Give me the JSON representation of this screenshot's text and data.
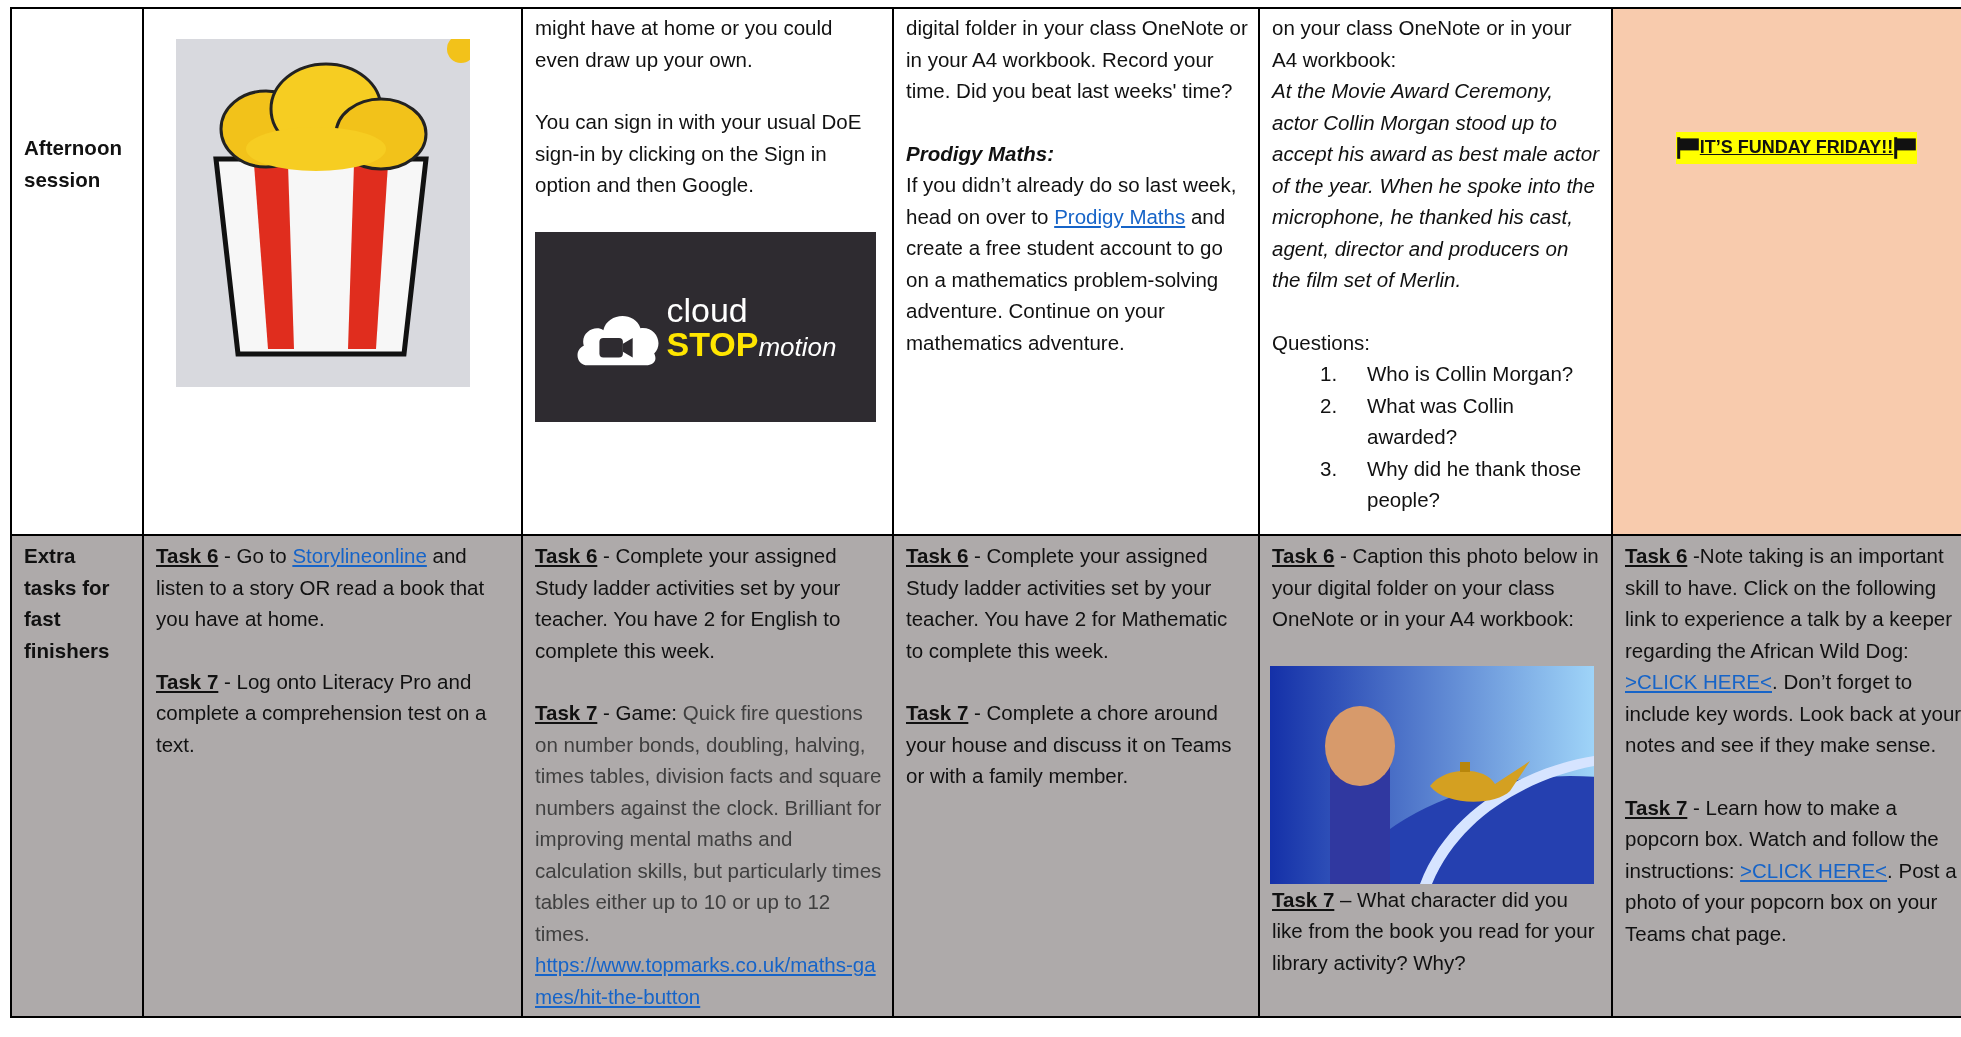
{
  "rows": [
    {
      "header": "Afternoon session",
      "cells": [
        {
          "color": "#ffffff",
          "blocks": [
            {
              "kind": "picture"
            }
          ]
        },
        {
          "color": "#ffffff",
          "blocks": [
            {
              "kind": "para",
              "segments": [
                {
                  "kind": "text",
                  "text": "might have at home or you could even draw up your own."
                }
              ]
            },
            {
              "kind": "para",
              "segments": [
                {
                  "kind": "text",
                  "text": "You can sign in with your usual DoE sign-in by clicking on the Sign in option and then Google."
                }
              ]
            },
            {
              "kind": "logo",
              "word": "cloud",
              "strong": "STOP",
              "rest": "motion"
            }
          ]
        },
        {
          "color": "#ffffff",
          "blocks": [
            {
              "kind": "para",
              "segments": [
                {
                  "kind": "text",
                  "text": "digital folder in your class OneNote or in your A4 workbook. Record your time. Did you beat last weeks' time?"
                }
              ]
            },
            {
              "kind": "heading",
              "text": "Prodigy Maths:"
            },
            {
              "kind": "para",
              "segments": [
                {
                  "kind": "text",
                  "text": "If you didn’t already do so last week, head on over to "
                },
                {
                  "kind": "link",
                  "text": "Prodigy Maths"
                },
                {
                  "kind": "text",
                  "text": " and create a free student account to go on a mathematics problem-solving adventure. Continue on your mathematics adventure."
                }
              ]
            }
          ]
        },
        {
          "color": "#ffffff",
          "blocks": [
            {
              "kind": "lead",
              "segments": [
                {
                  "kind": "text",
                  "text": "on your class OneNote or in your A4 workbook:"
                }
              ]
            },
            {
              "kind": "quote",
              "text": "At the Movie Award Ceremony, actor Collin Morgan stood up to accept his award as best male actor of the year. When he spoke into the microphone, he thanked his cast, agent, director and producers on the film set of Merlin."
            },
            {
              "kind": "lead",
              "segments": [
                {
                  "kind": "text",
                  "text": "Questions:"
                }
              ]
            },
            {
              "kind": "list",
              "items": [
                {
                  "number": "1.",
                  "text": "Who is Collin Morgan?"
                },
                {
                  "number": "2.",
                  "text": "What was Collin awarded?"
                },
                {
                  "number": "3.",
                  "text": "Why did he thank those people?"
                }
              ]
            }
          ]
        },
        {
          "color": "#f8cbad",
          "blocks": [
            {
              "kind": "banner",
              "text": "IT’S FUNDAY FRIDAY!!"
            }
          ]
        }
      ]
    },
    {
      "header": "Extra tasks for fast finishers",
      "cells": [
        {
          "color": "#aeaaaa",
          "blocks": [
            {
              "kind": "para",
              "segments": [
                {
                  "kind": "label",
                  "text": "Task 6"
                },
                {
                  "kind": "text",
                  "text": " - Go to "
                },
                {
                  "kind": "link",
                  "text": "Storylineonline"
                },
                {
                  "kind": "text",
                  "text": " and listen to a story OR read a book that you have at home."
                }
              ]
            },
            {
              "kind": "para",
              "segments": [
                {
                  "kind": "label",
                  "text": "Task 7"
                },
                {
                  "kind": "text",
                  "text": " -  Log onto Literacy Pro and complete a comprehension test on a text."
                }
              ]
            }
          ]
        },
        {
          "color": "#aeaaaa",
          "blocks": [
            {
              "kind": "para",
              "segments": [
                {
                  "kind": "label",
                  "text": "Task 6"
                },
                {
                  "kind": "text",
                  "text": " - Complete your assigned Study ladder activities set by your teacher. You have 2 for English to complete this week."
                }
              ]
            },
            {
              "kind": "lead",
              "segments": [
                {
                  "kind": "label",
                  "text": "Task 7"
                },
                {
                  "kind": "text",
                  "text": " - Game: "
                },
                {
                  "kind": "muted",
                  "text": "Quick fire questions on number bonds, doubling, halving, times tables, division facts and square numbers against the clock. Brilliant for improving mental maths and calculation skills, but particularly times tables either up to 10 or up to 12 times."
                }
              ]
            },
            {
              "kind": "url",
              "text": "https://www.topmarks.co.uk/maths-games/hit-the-button"
            }
          ]
        },
        {
          "color": "#aeaaaa",
          "blocks": [
            {
              "kind": "para",
              "segments": [
                {
                  "kind": "label",
                  "text": "Task 6"
                },
                {
                  "kind": "text",
                  "text": " - Complete your assigned Study ladder activities set by your teacher. You have 2 for Mathematic to complete this week."
                }
              ]
            },
            {
              "kind": "para",
              "segments": [
                {
                  "kind": "label",
                  "text": "Task 7"
                },
                {
                  "kind": "text",
                  "text": " - Complete a chore around your house and discuss it on Teams or with a family member."
                }
              ]
            }
          ]
        },
        {
          "color": "#aeaaaa",
          "blocks": [
            {
              "kind": "para",
              "segments": [
                {
                  "kind": "label",
                  "text": "Task 6"
                },
                {
                  "kind": "text",
                  "text": " - Caption this photo below in your digital folder on your class OneNote or in your A4 workbook:"
                }
              ]
            },
            {
              "kind": "picture"
            },
            {
              "kind": "lead",
              "segments": [
                {
                  "kind": "label",
                  "text": "Task 7"
                },
                {
                  "kind": "text",
                  "text": " – What character did you like from the book you read for your library activity? Why?"
                }
              ]
            }
          ]
        },
        {
          "color": "#aeaaaa",
          "blocks": [
            {
              "kind": "para",
              "segments": [
                {
                  "kind": "label",
                  "text": "Task 6"
                },
                {
                  "kind": "text",
                  "text": " -Note taking is an important skill to have. Click on the following link to experience a talk by a keeper regarding the African Wild Dog: "
                },
                {
                  "kind": "link",
                  "text": ">CLICK HERE<"
                },
                {
                  "kind": "text",
                  "text": ". Don’t forget to include key words. Look back at your notes and see if they make sense."
                }
              ]
            },
            {
              "kind": "para",
              "segments": [
                {
                  "kind": "label",
                  "text": "Task 7"
                },
                {
                  "kind": "text",
                  "text": " - Learn how to make a popcorn box. Watch and follow the instructions: "
                },
                {
                  "kind": "link",
                  "text": ">CLICK HERE<"
                },
                {
                  "kind": "text",
                  "text": ". Post a photo of your popcorn box on your Teams chat page."
                }
              ]
            }
          ]
        }
      ]
    }
  ]
}
